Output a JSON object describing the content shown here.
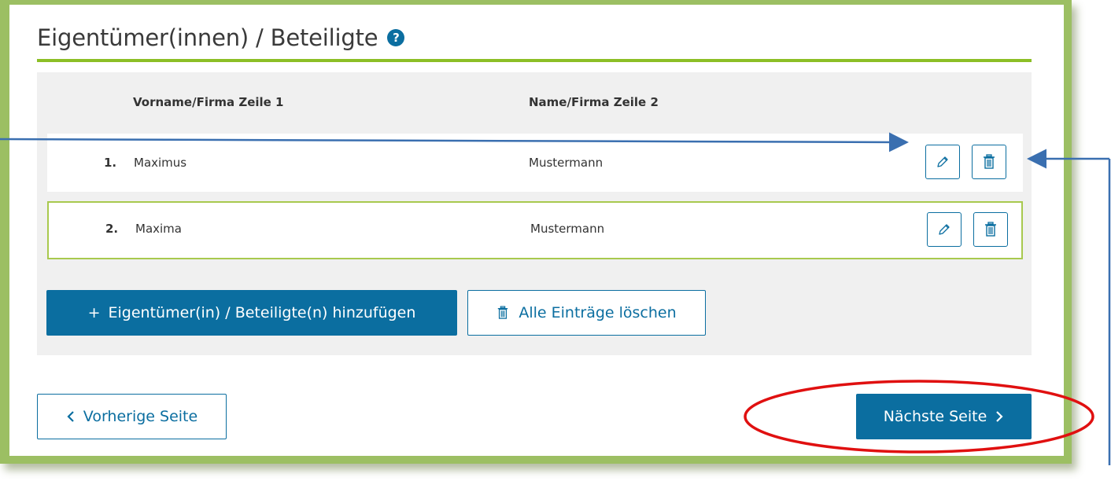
{
  "section": {
    "title": "Eigentümer(innen) / Beteiligte",
    "help_icon": "?"
  },
  "table": {
    "columns": [
      "Vorname/Firma Zeile 1",
      "Name/Firma Zeile 2"
    ],
    "rows": [
      {
        "number": "1.",
        "first": "Maximus",
        "last": "Mustermann"
      },
      {
        "number": "2.",
        "first": "Maxima",
        "last": "Mustermann"
      }
    ]
  },
  "actions": {
    "add_label": "Eigentümer(in) / Beteiligte(n) hinzufügen",
    "add_prefix": "+",
    "delete_all_label": "Alle Einträge löschen"
  },
  "navigation": {
    "prev_label": "Vorherige Seite",
    "next_label": "Nächste Seite"
  },
  "icons": {
    "edit": "pencil-icon",
    "delete": "trash-icon",
    "help": "help-icon",
    "prev": "chevron-left-icon",
    "next": "chevron-right-icon"
  },
  "colors": {
    "frame_green": "#9cbf63",
    "accent_green": "#8cbf26",
    "primary_blue": "#0b6ea0",
    "annotation_red": "#e01010",
    "annotation_blue": "#3a6fb0"
  }
}
